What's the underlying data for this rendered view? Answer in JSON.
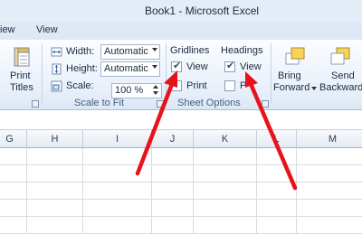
{
  "window": {
    "title": "Book1  -  Microsoft Excel"
  },
  "tabs": {
    "items": [
      "iew",
      "View"
    ]
  },
  "print_titles": {
    "label_line1": "Print",
    "label_line2": "Titles"
  },
  "scale_to_fit": {
    "width_label": "Width:",
    "width_value": "Automatic",
    "height_label": "Height:",
    "height_value": "Automatic",
    "scale_label": "Scale:",
    "scale_value": "100 %",
    "group_label": "Scale to Fit"
  },
  "sheet_options": {
    "gridlines_header": "Gridlines",
    "gridlines_view_label": "View",
    "gridlines_view_checked": true,
    "gridlines_print_label": "Print",
    "gridlines_print_checked": false,
    "headings_header": "Headings",
    "headings_view_label": "View",
    "headings_view_checked": true,
    "headings_print_label": "P",
    "headings_print_checked": false,
    "group_label": "Sheet Options"
  },
  "arrange": {
    "bring_forward_line1": "Bring",
    "bring_forward_line2": "Forward",
    "send_backward_line1": "Send",
    "send_backward_line2": "Backward"
  },
  "columns": [
    "G",
    "H",
    "I",
    "J",
    "K",
    "L",
    "M"
  ],
  "annotation": {
    "arrow_color": "#e8121a"
  }
}
